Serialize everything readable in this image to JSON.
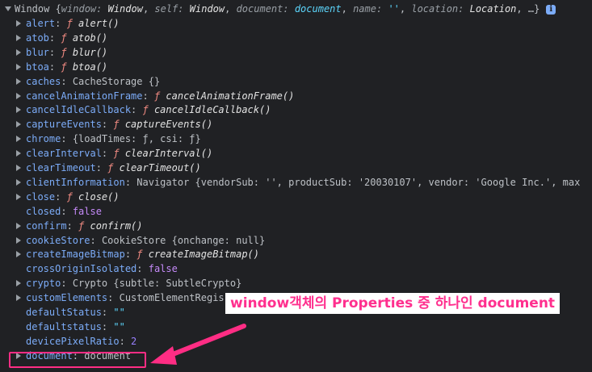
{
  "header": {
    "prefix": "Window {",
    "preview_parts": [
      {
        "k": "window",
        "v": "Window"
      },
      {
        "k": "self",
        "v": "Window"
      },
      {
        "k": "document",
        "v": "document"
      },
      {
        "k": "name",
        "v": "''"
      },
      {
        "k": "location",
        "v": "Location"
      }
    ],
    "suffix": ", …}",
    "info_icon": "i"
  },
  "rows": [
    {
      "key": "alert",
      "type": "fn",
      "value": "alert()"
    },
    {
      "key": "atob",
      "type": "fn",
      "value": "atob()"
    },
    {
      "key": "blur",
      "type": "fn",
      "value": "blur()"
    },
    {
      "key": "btoa",
      "type": "fn",
      "value": "btoa()"
    },
    {
      "key": "caches",
      "type": "obj",
      "value": "CacheStorage {}"
    },
    {
      "key": "cancelAnimationFrame",
      "type": "fn",
      "value": "cancelAnimationFrame()"
    },
    {
      "key": "cancelIdleCallback",
      "type": "fn",
      "value": "cancelIdleCallback()"
    },
    {
      "key": "captureEvents",
      "type": "fn",
      "value": "captureEvents()"
    },
    {
      "key": "chrome",
      "type": "obj",
      "value": "{loadTimes: ƒ, csi: ƒ}"
    },
    {
      "key": "clearInterval",
      "type": "fn",
      "value": "clearInterval()"
    },
    {
      "key": "clearTimeout",
      "type": "fn",
      "value": "clearTimeout()"
    },
    {
      "key": "clientInformation",
      "type": "obj",
      "value": "Navigator {vendorSub: '', productSub: '20030107', vendor: 'Google Inc.', max"
    },
    {
      "key": "close",
      "type": "fn",
      "value": "close()"
    },
    {
      "key": "closed",
      "type": "bool",
      "value": "false",
      "noexpand": true
    },
    {
      "key": "confirm",
      "type": "fn",
      "value": "confirm()"
    },
    {
      "key": "cookieStore",
      "type": "obj",
      "value": "CookieStore {onchange: null}"
    },
    {
      "key": "createImageBitmap",
      "type": "fn",
      "value": "createImageBitmap()"
    },
    {
      "key": "crossOriginIsolated",
      "type": "bool",
      "value": "false",
      "noexpand": true
    },
    {
      "key": "crypto",
      "type": "obj",
      "value": "Crypto {subtle: SubtleCrypto}"
    },
    {
      "key": "customElements",
      "type": "obj",
      "value": "CustomElementRegis"
    },
    {
      "key": "defaultStatus",
      "type": "str",
      "value": "\"\"",
      "noexpand": true
    },
    {
      "key": "defaultstatus",
      "type": "str",
      "value": "\"\"",
      "noexpand": true
    },
    {
      "key": "devicePixelRatio",
      "type": "num",
      "value": "2",
      "noexpand": true
    },
    {
      "key": "document",
      "type": "obj",
      "value": "document"
    }
  ],
  "fn_glyph": "ƒ",
  "annotation": {
    "text": "window객체의 Properties 중 하나인 document"
  },
  "colors": {
    "background": "#202124",
    "key": "#7cacf8",
    "function": "#f28b82",
    "string": "#5cd5fb",
    "boolean": "#c58af9",
    "number": "#9980ff",
    "highlight": "#ff2d84"
  }
}
